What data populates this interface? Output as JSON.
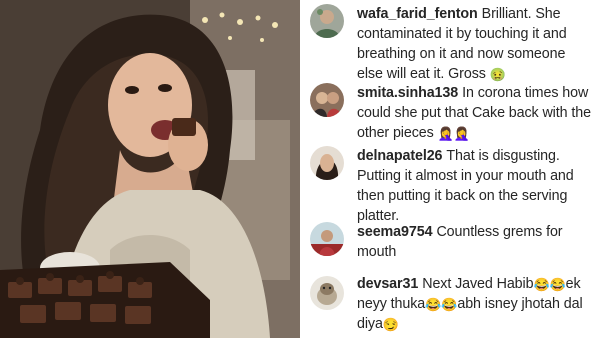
{
  "comments": [
    {
      "username": "wafa_farid_fenton",
      "text": "Brilliant. She contaminated it by touching it and breathing on it and now someone else will eat it. Gross",
      "emoji": "🤢"
    },
    {
      "username": "smita.sinha138",
      "text": "In corona times how could she put that Cake back with the other pieces",
      "emoji": "🤦‍♀️🤦‍♀️"
    },
    {
      "username": "delnapatel26",
      "text": "That is disgusting. Putting it almost in your mouth and then putting it back on the serving platter."
    },
    {
      "username": "seema9754",
      "text": "Countless grems for mouth"
    },
    {
      "username": "devsar31",
      "text_part1": "Next Javed Habib",
      "emoji1": "😂😂",
      "text_part2": "ek neyy thuka",
      "emoji2": "😂😂",
      "text_part3": "abh isney jhotah dal diya",
      "emoji3": "😏"
    }
  ]
}
